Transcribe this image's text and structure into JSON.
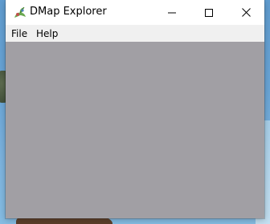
{
  "window": {
    "title": "DMap Explorer",
    "app_icon": "dmap-app-icon",
    "controls": {
      "minimize_icon": "minimize-icon",
      "maximize_icon": "maximize-icon",
      "close_icon": "close-icon"
    }
  },
  "menu": {
    "items": [
      {
        "label": "File"
      },
      {
        "label": "Help"
      }
    ]
  },
  "colors": {
    "client_area": "#a19fa4",
    "menubar": "#f0f0f0",
    "titlebar": "#ffffff"
  }
}
